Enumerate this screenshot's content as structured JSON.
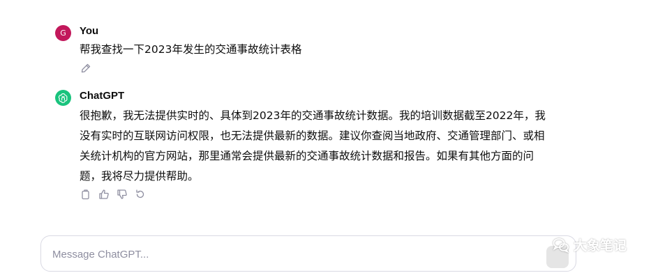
{
  "conversation": {
    "user_message": {
      "avatar_initial": "G",
      "author": "You",
      "text": "帮我查找一下2023年发生的交通事故统计表格"
    },
    "assistant_message": {
      "author": "ChatGPT",
      "lines": [
        "很抱歉，我无法提供实时的、具体到2023年的交通事故统计数据。我的培训数据截至2022年，我",
        "没有实时的互联网访问权限，也无法提供最新的数据。建议你查阅当地政府、交通管理部门、或相",
        "关统计机构的官方网站，那里通常会提供最新的交通事故统计数据和报告。如果有其他方面的问",
        "题，我将尽力提供帮助。"
      ]
    }
  },
  "composer": {
    "placeholder": "Message ChatGPT..."
  },
  "watermark": {
    "text": "大象笔记"
  },
  "colors": {
    "user_avatar": "#c2185b",
    "chatgpt_avatar": "#19c37d",
    "icon_gray": "#8e8ea0"
  }
}
